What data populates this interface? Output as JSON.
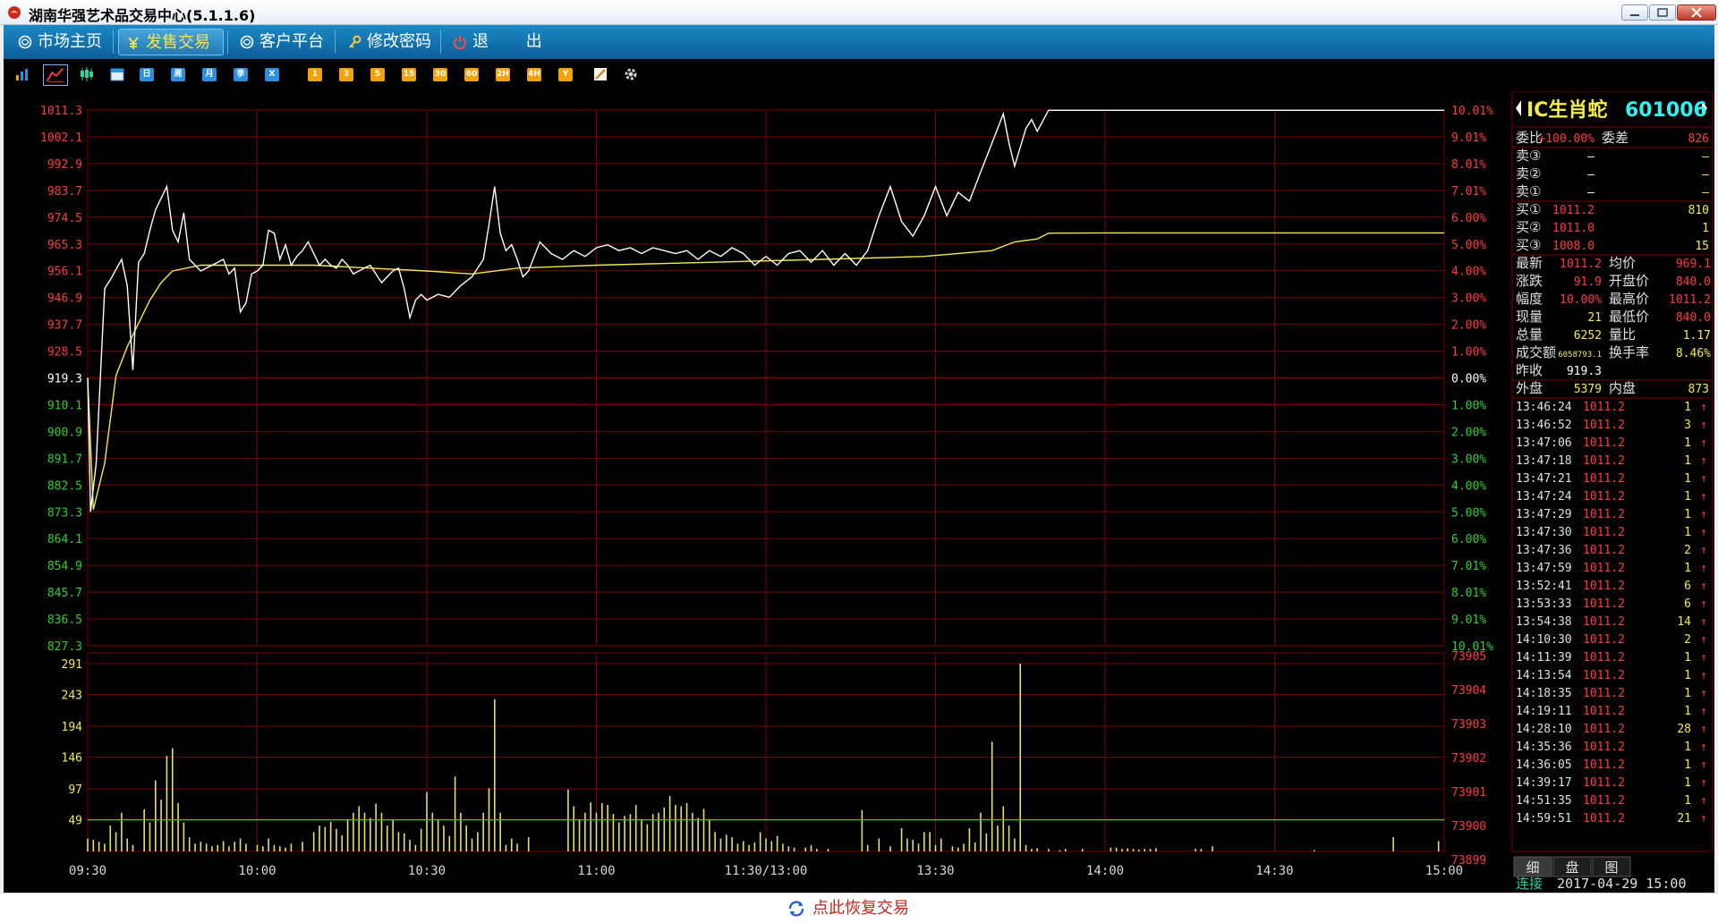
{
  "window": {
    "title": "湖南华强艺术品交易中心(5.1.1.6)"
  },
  "nav": {
    "items": [
      {
        "label": "市场主页",
        "icon": "globe-icon"
      },
      {
        "label": "发售交易",
        "icon": "yen-icon",
        "active": true
      },
      {
        "label": "客户平台",
        "icon": "globe-icon"
      },
      {
        "label": "修改密码",
        "icon": "key-icon"
      },
      {
        "label": "退",
        "icon": "power-icon"
      },
      {
        "label": "出",
        "icon": ""
      }
    ]
  },
  "toolbar": {
    "icons": [
      "bar-chart-icon",
      "line-chart-icon",
      "candlestick-icon",
      "calendar-icon"
    ],
    "period_buttons": [
      "日",
      "周",
      "月",
      "季",
      "X"
    ],
    "minute_buttons": [
      "1",
      "3",
      "5",
      "15",
      "30",
      "60",
      "2H",
      "4H",
      "Y"
    ],
    "tool_icons": [
      "draw-icon",
      "gear-icon"
    ]
  },
  "colors": {
    "grid": "#7a0000",
    "up": "#ff3b3b",
    "down": "#2fd12f",
    "price_line": "#ffffff",
    "avg_line": "#f5ea4c",
    "volume_bar": "#e8e06a",
    "volume_ref": "#2fd12f",
    "nav_active": "#ffe14a",
    "restore_link": "#c0241a"
  },
  "chart_data": {
    "type": "line",
    "x_ticks": [
      "09:30",
      "10:00",
      "10:30",
      "11:00",
      "11:30/13:00",
      "13:30",
      "14:00",
      "14:30",
      "15:00"
    ],
    "price_ticks": [
      "1011.3",
      "1002.1",
      "992.9",
      "983.7",
      "974.5",
      "965.3",
      "956.1",
      "946.9",
      "937.7",
      "928.5",
      "919.3",
      "910.1",
      "900.9",
      "891.7",
      "882.5",
      "873.3",
      "864.1",
      "854.9",
      "845.7",
      "836.5",
      "827.3"
    ],
    "pct_ticks": [
      "10.01%",
      "9.01%",
      "8.01%",
      "7.01%",
      "6.00%",
      "5.00%",
      "4.00%",
      "3.00%",
      "2.00%",
      "1.00%",
      "0.00%",
      "1.00%",
      "2.00%",
      "3.00%",
      "4.00%",
      "5.00%",
      "6.00%",
      "7.01%",
      "8.01%",
      "9.01%",
      "10.01%"
    ],
    "prev_close": 919.3,
    "ylim": [
      827.3,
      1011.3
    ],
    "price": [
      [
        0,
        919.3
      ],
      [
        0.5,
        873.3
      ],
      [
        1.5,
        890
      ],
      [
        3,
        950
      ],
      [
        4,
        953
      ],
      [
        6,
        960
      ],
      [
        7,
        951
      ],
      [
        8,
        922
      ],
      [
        9,
        959
      ],
      [
        10,
        962
      ],
      [
        11,
        970
      ],
      [
        12,
        977
      ],
      [
        14,
        985
      ],
      [
        15,
        970
      ],
      [
        16,
        966
      ],
      [
        17,
        976
      ],
      [
        18,
        960
      ],
      [
        20,
        956
      ],
      [
        22,
        958
      ],
      [
        24,
        960
      ],
      [
        25,
        955
      ],
      [
        26,
        957
      ],
      [
        27,
        942
      ],
      [
        28,
        945
      ],
      [
        29,
        955
      ],
      [
        30,
        956
      ],
      [
        31,
        958
      ],
      [
        32,
        970
      ],
      [
        33,
        969
      ],
      [
        34,
        960
      ],
      [
        35,
        965
      ],
      [
        36,
        958
      ],
      [
        37,
        961
      ],
      [
        38,
        963
      ],
      [
        39,
        966
      ],
      [
        40,
        962
      ],
      [
        41,
        958
      ],
      [
        42,
        960
      ],
      [
        43,
        958
      ],
      [
        44,
        957
      ],
      [
        45,
        960
      ],
      [
        46,
        958
      ],
      [
        47,
        955
      ],
      [
        48,
        956
      ],
      [
        49,
        957
      ],
      [
        50,
        958
      ],
      [
        51,
        955
      ],
      [
        52,
        952
      ],
      [
        53,
        954
      ],
      [
        54,
        956
      ],
      [
        55,
        957
      ],
      [
        56,
        950
      ],
      [
        57,
        940
      ],
      [
        58,
        946
      ],
      [
        59,
        948
      ],
      [
        60,
        946
      ],
      [
        62,
        948
      ],
      [
        64,
        947
      ],
      [
        66,
        951
      ],
      [
        68,
        954
      ],
      [
        70,
        960
      ],
      [
        71,
        972
      ],
      [
        72,
        985
      ],
      [
        73,
        969
      ],
      [
        74,
        963
      ],
      [
        75,
        965
      ],
      [
        76,
        960
      ],
      [
        77,
        954
      ],
      [
        78,
        956
      ],
      [
        79,
        961
      ],
      [
        80,
        966
      ],
      [
        82,
        962
      ],
      [
        84,
        960
      ],
      [
        86,
        963
      ],
      [
        88,
        961
      ],
      [
        90,
        964
      ],
      [
        92,
        965
      ],
      [
        94,
        963
      ],
      [
        96,
        964
      ],
      [
        98,
        962
      ],
      [
        100,
        964
      ],
      [
        102,
        963
      ],
      [
        104,
        962
      ],
      [
        106,
        963
      ],
      [
        108,
        960
      ],
      [
        110,
        963
      ],
      [
        112,
        961
      ],
      [
        114,
        964
      ],
      [
        116,
        962
      ],
      [
        118,
        958
      ],
      [
        120,
        961
      ],
      [
        122,
        958
      ],
      [
        124,
        962
      ],
      [
        126,
        963
      ],
      [
        128,
        959
      ],
      [
        130,
        963
      ],
      [
        132,
        958
      ],
      [
        134,
        962
      ],
      [
        136,
        958
      ],
      [
        138,
        963
      ],
      [
        140,
        975
      ],
      [
        142,
        985
      ],
      [
        144,
        973
      ],
      [
        146,
        968
      ],
      [
        148,
        975
      ],
      [
        150,
        985
      ],
      [
        152,
        975
      ],
      [
        154,
        983
      ],
      [
        156,
        980
      ],
      [
        158,
        990
      ],
      [
        160,
        1000
      ],
      [
        162,
        1010
      ],
      [
        163,
        1000
      ],
      [
        164,
        992
      ],
      [
        166,
        1005
      ],
      [
        167,
        1008
      ],
      [
        168,
        1004
      ],
      [
        170,
        1011.2
      ],
      [
        240,
        1011.2
      ]
    ],
    "avg": [
      [
        0,
        919.3
      ],
      [
        1,
        874
      ],
      [
        3,
        890
      ],
      [
        5,
        920
      ],
      [
        7,
        930
      ],
      [
        9,
        938
      ],
      [
        11,
        946
      ],
      [
        13,
        952
      ],
      [
        15,
        956
      ],
      [
        20,
        958
      ],
      [
        30,
        958
      ],
      [
        40,
        958
      ],
      [
        50,
        957
      ],
      [
        60,
        956
      ],
      [
        68,
        955
      ],
      [
        76,
        957
      ],
      [
        90,
        958
      ],
      [
        110,
        959
      ],
      [
        130,
        960
      ],
      [
        148,
        961
      ],
      [
        160,
        963
      ],
      [
        164,
        966
      ],
      [
        168,
        967
      ],
      [
        170,
        969
      ],
      [
        180,
        969.1
      ],
      [
        220,
        969.1
      ],
      [
        240,
        969.1
      ]
    ],
    "volume_ticks": [
      "291",
      "243",
      "194",
      "146",
      "97",
      "49"
    ],
    "volume_right_ticks": [
      "73905",
      "73904",
      "73903",
      "73902",
      "73901",
      "73900",
      "73899"
    ],
    "volume_ylim": [
      0,
      291
    ],
    "volume_ref": 49,
    "volume": [
      [
        0,
        20
      ],
      [
        1,
        18
      ],
      [
        2,
        15
      ],
      [
        3,
        12
      ],
      [
        4,
        40
      ],
      [
        5,
        30
      ],
      [
        6,
        60
      ],
      [
        7,
        20
      ],
      [
        8,
        10
      ],
      [
        10,
        65
      ],
      [
        11,
        45
      ],
      [
        12,
        110
      ],
      [
        13,
        80
      ],
      [
        14,
        148
      ],
      [
        15,
        160
      ],
      [
        16,
        75
      ],
      [
        17,
        45
      ],
      [
        18,
        22
      ],
      [
        19,
        12
      ],
      [
        20,
        15
      ],
      [
        21,
        12
      ],
      [
        22,
        8
      ],
      [
        23,
        10
      ],
      [
        24,
        16
      ],
      [
        25,
        8
      ],
      [
        26,
        15
      ],
      [
        27,
        20
      ],
      [
        28,
        12
      ],
      [
        30,
        10
      ],
      [
        31,
        8
      ],
      [
        32,
        20
      ],
      [
        33,
        10
      ],
      [
        34,
        8
      ],
      [
        35,
        6
      ],
      [
        36,
        12
      ],
      [
        38,
        15
      ],
      [
        40,
        30
      ],
      [
        41,
        40
      ],
      [
        42,
        38
      ],
      [
        43,
        46
      ],
      [
        44,
        35
      ],
      [
        45,
        25
      ],
      [
        46,
        50
      ],
      [
        47,
        60
      ],
      [
        48,
        70
      ],
      [
        49,
        60
      ],
      [
        50,
        52
      ],
      [
        51,
        74
      ],
      [
        52,
        60
      ],
      [
        53,
        40
      ],
      [
        54,
        50
      ],
      [
        55,
        30
      ],
      [
        56,
        28
      ],
      [
        57,
        18
      ],
      [
        58,
        10
      ],
      [
        59,
        35
      ],
      [
        60,
        92
      ],
      [
        61,
        60
      ],
      [
        62,
        50
      ],
      [
        63,
        40
      ],
      [
        64,
        24
      ],
      [
        65,
        116
      ],
      [
        66,
        60
      ],
      [
        67,
        40
      ],
      [
        68,
        20
      ],
      [
        69,
        30
      ],
      [
        70,
        60
      ],
      [
        71,
        98
      ],
      [
        72,
        236
      ],
      [
        73,
        60
      ],
      [
        74,
        10
      ],
      [
        75,
        20
      ],
      [
        76,
        12
      ],
      [
        78,
        22
      ],
      [
        85,
        96
      ],
      [
        86,
        70
      ],
      [
        87,
        50
      ],
      [
        88,
        60
      ],
      [
        89,
        76
      ],
      [
        90,
        60
      ],
      [
        91,
        75
      ],
      [
        92,
        72
      ],
      [
        93,
        58
      ],
      [
        94,
        45
      ],
      [
        95,
        55
      ],
      [
        96,
        58
      ],
      [
        97,
        72
      ],
      [
        98,
        50
      ],
      [
        99,
        42
      ],
      [
        100,
        58
      ],
      [
        101,
        60
      ],
      [
        102,
        68
      ],
      [
        103,
        86
      ],
      [
        104,
        72
      ],
      [
        105,
        70
      ],
      [
        106,
        75
      ],
      [
        107,
        60
      ],
      [
        108,
        52
      ],
      [
        109,
        66
      ],
      [
        110,
        50
      ],
      [
        111,
        30
      ],
      [
        112,
        20
      ],
      [
        113,
        26
      ],
      [
        114,
        22
      ],
      [
        115,
        12
      ],
      [
        116,
        16
      ],
      [
        117,
        10
      ],
      [
        118,
        14
      ],
      [
        119,
        30
      ],
      [
        120,
        20
      ],
      [
        121,
        16
      ],
      [
        122,
        24
      ],
      [
        123,
        12
      ],
      [
        124,
        8
      ],
      [
        125,
        6
      ],
      [
        127,
        6
      ],
      [
        128,
        10
      ],
      [
        129,
        4
      ],
      [
        131,
        4
      ],
      [
        137,
        64
      ],
      [
        138,
        10
      ],
      [
        140,
        20
      ],
      [
        142,
        8
      ],
      [
        144,
        36
      ],
      [
        145,
        20
      ],
      [
        146,
        18
      ],
      [
        147,
        12
      ],
      [
        148,
        30
      ],
      [
        149,
        30
      ],
      [
        150,
        10
      ],
      [
        151,
        20
      ],
      [
        153,
        8
      ],
      [
        154,
        6
      ],
      [
        155,
        12
      ],
      [
        156,
        36
      ],
      [
        157,
        14
      ],
      [
        158,
        60
      ],
      [
        159,
        28
      ],
      [
        160,
        170
      ],
      [
        161,
        40
      ],
      [
        162,
        70
      ],
      [
        163,
        40
      ],
      [
        164,
        20
      ],
      [
        165,
        291
      ],
      [
        166,
        10
      ],
      [
        167,
        4
      ],
      [
        168,
        5
      ],
      [
        170,
        4
      ],
      [
        172,
        2
      ],
      [
        173,
        4
      ],
      [
        176,
        4
      ],
      [
        181,
        6
      ],
      [
        182,
        6
      ],
      [
        183,
        4
      ],
      [
        184,
        5
      ],
      [
        185,
        4
      ],
      [
        186,
        3
      ],
      [
        187,
        4
      ],
      [
        188,
        4
      ],
      [
        189,
        5
      ],
      [
        196,
        4
      ],
      [
        197,
        4
      ],
      [
        199,
        8
      ],
      [
        217,
        2
      ],
      [
        231,
        22
      ],
      [
        239,
        16
      ]
    ]
  },
  "panel": {
    "symbol_name": "IC生肖蛇",
    "symbol_code": "601006",
    "weibi_label": "委比",
    "weibi_value": "+100.00%",
    "weicha_label": "委差",
    "weicha_value": "826",
    "sell": [
      {
        "label": "卖③",
        "price": "—",
        "vol": "—"
      },
      {
        "label": "卖②",
        "price": "—",
        "vol": "—"
      },
      {
        "label": "卖①",
        "price": "—",
        "vol": "—"
      }
    ],
    "buy": [
      {
        "label": "买①",
        "price": "1011.2",
        "vol": "810"
      },
      {
        "label": "买②",
        "price": "1011.0",
        "vol": "1"
      },
      {
        "label": "买③",
        "price": "1008.0",
        "vol": "15"
      }
    ],
    "stats": [
      {
        "l1": "最新",
        "v1": "1011.2",
        "l2": "均价",
        "v2": "969.1"
      },
      {
        "l1": "涨跌",
        "v1": "91.9",
        "l2": "开盘价",
        "v2": "840.0"
      },
      {
        "l1": "幅度",
        "v1": "10.00%",
        "l2": "最高价",
        "v2": "1011.2"
      },
      {
        "l1": "现量",
        "v1": "21",
        "l2": "最低价",
        "v2": "840.0"
      },
      {
        "l1": "总量",
        "v1": "6252",
        "l2": "量比",
        "v2": "1.17"
      },
      {
        "l1": "成交额",
        "v1": "6058793.1",
        "l2": "换手率",
        "v2": "8.46%"
      },
      {
        "l1": "昨收",
        "v1": "919.3",
        "l2": "",
        "v2": ""
      }
    ],
    "waipan_label": "外盘",
    "waipan_value": "5379",
    "neipan_label": "内盘",
    "neipan_value": "873",
    "ticks": [
      {
        "time": "13:46:24",
        "price": "1011.2",
        "vol": "1"
      },
      {
        "time": "13:46:52",
        "price": "1011.2",
        "vol": "3"
      },
      {
        "time": "13:47:06",
        "price": "1011.2",
        "vol": "1"
      },
      {
        "time": "13:47:18",
        "price": "1011.2",
        "vol": "1"
      },
      {
        "time": "13:47:21",
        "price": "1011.2",
        "vol": "1"
      },
      {
        "time": "13:47:24",
        "price": "1011.2",
        "vol": "1"
      },
      {
        "time": "13:47:29",
        "price": "1011.2",
        "vol": "1"
      },
      {
        "time": "13:47:30",
        "price": "1011.2",
        "vol": "1"
      },
      {
        "time": "13:47:36",
        "price": "1011.2",
        "vol": "2"
      },
      {
        "time": "13:47:59",
        "price": "1011.2",
        "vol": "1"
      },
      {
        "time": "13:52:41",
        "price": "1011.2",
        "vol": "6"
      },
      {
        "time": "13:53:33",
        "price": "1011.2",
        "vol": "6"
      },
      {
        "time": "13:54:38",
        "price": "1011.2",
        "vol": "14"
      },
      {
        "time": "14:10:30",
        "price": "1011.2",
        "vol": "2"
      },
      {
        "time": "14:11:39",
        "price": "1011.2",
        "vol": "1"
      },
      {
        "time": "14:13:54",
        "price": "1011.2",
        "vol": "1"
      },
      {
        "time": "14:18:35",
        "price": "1011.2",
        "vol": "1"
      },
      {
        "time": "14:19:11",
        "price": "1011.2",
        "vol": "1"
      },
      {
        "time": "14:28:10",
        "price": "1011.2",
        "vol": "28"
      },
      {
        "time": "14:35:36",
        "price": "1011.2",
        "vol": "1"
      },
      {
        "time": "14:36:05",
        "price": "1011.2",
        "vol": "1"
      },
      {
        "time": "14:39:17",
        "price": "1011.2",
        "vol": "1"
      },
      {
        "time": "14:51:35",
        "price": "1011.2",
        "vol": "1"
      },
      {
        "time": "14:59:51",
        "price": "1011.2",
        "vol": "21"
      }
    ],
    "tick_arrow": "↑",
    "tabs": [
      "细",
      "盘",
      "图"
    ],
    "status_label": "连接",
    "datetime": "2017-04-29 15:00"
  },
  "bottom": {
    "restore_label": "点此恢复交易"
  }
}
